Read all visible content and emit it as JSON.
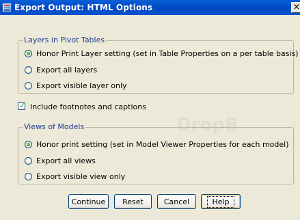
{
  "window": {
    "title": "Export Output: HTML Options",
    "close_glyph": "×"
  },
  "layers_group": {
    "legend": "Layers in Pivot Tables",
    "options": [
      {
        "label": "Honor Print Layer setting (set in Table Properties on a per table basis)",
        "checked": true
      },
      {
        "label": "Export all layers",
        "checked": false
      },
      {
        "label": "Export visible layer only",
        "checked": false
      }
    ]
  },
  "footnotes": {
    "label": "Include footnotes and captions",
    "checked": true
  },
  "models_group": {
    "legend": "Views of Models",
    "options": [
      {
        "label": "Honor print setting (set in Model Viewer Properties for each model)",
        "checked": true
      },
      {
        "label": "Export all views",
        "checked": false
      },
      {
        "label": "Export visible view only",
        "checked": false
      }
    ]
  },
  "buttons": {
    "continue": "Continue",
    "reset": "Reset",
    "cancel": "Cancel",
    "help": "Help"
  },
  "watermark": "DropB"
}
